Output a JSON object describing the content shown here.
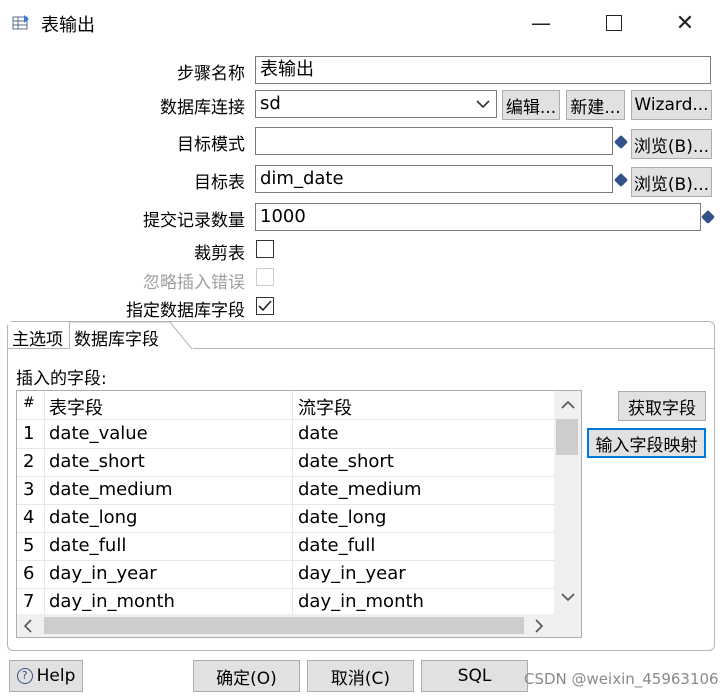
{
  "window": {
    "title": "表输出",
    "minimize_icon": "minimize-icon",
    "maximize_icon": "maximize-icon",
    "close_icon": "close-icon"
  },
  "form": {
    "step_name_label": "步骤名称",
    "step_name_value": "表输出",
    "db_connection_label": "数据库连接",
    "db_connection_value": "sd",
    "edit_button": "编辑...",
    "new_button": "新建...",
    "wizard_button": "Wizard...",
    "target_schema_label": "目标模式",
    "target_schema_value": "",
    "browse_schema_button": "浏览(B)...",
    "target_table_label": "目标表",
    "target_table_value": "dim_date",
    "browse_table_button": "浏览(B)...",
    "commit_size_label": "提交记录数量",
    "commit_size_value": "1000",
    "truncate_label": "裁剪表",
    "truncate_checked": false,
    "ignore_errors_label": "忽略插入错误",
    "ignore_errors_checked": false,
    "specify_fields_label": "指定数据库字段",
    "specify_fields_checked": true
  },
  "tabs": [
    {
      "label": "主选项",
      "active": false
    },
    {
      "label": "数据库字段",
      "active": true
    }
  ],
  "fields_panel": {
    "label": "插入的字段:",
    "columns": [
      "#",
      "表字段",
      "流字段"
    ],
    "rows": [
      {
        "n": "1",
        "table_field": "date_value",
        "stream_field": "date"
      },
      {
        "n": "2",
        "table_field": "date_short",
        "stream_field": "date_short"
      },
      {
        "n": "3",
        "table_field": "date_medium",
        "stream_field": "date_medium"
      },
      {
        "n": "4",
        "table_field": "date_long",
        "stream_field": "date_long"
      },
      {
        "n": "5",
        "table_field": "date_full",
        "stream_field": "date_full"
      },
      {
        "n": "6",
        "table_field": "day_in_year",
        "stream_field": "day_in_year"
      },
      {
        "n": "7",
        "table_field": "day_in_month",
        "stream_field": "day_in_month"
      }
    ],
    "get_fields_button": "获取字段",
    "map_fields_button": "输入字段映射"
  },
  "footer": {
    "help_button": "Help",
    "ok_button": "确定(O)",
    "cancel_button": "取消(C)",
    "sql_button": "SQL",
    "watermark": "CSDN @weixin_45963106"
  },
  "colors": {
    "accent_border": "#0078d7",
    "button_bg": "#e1e1e1",
    "variable_diamond": "#35538b"
  }
}
